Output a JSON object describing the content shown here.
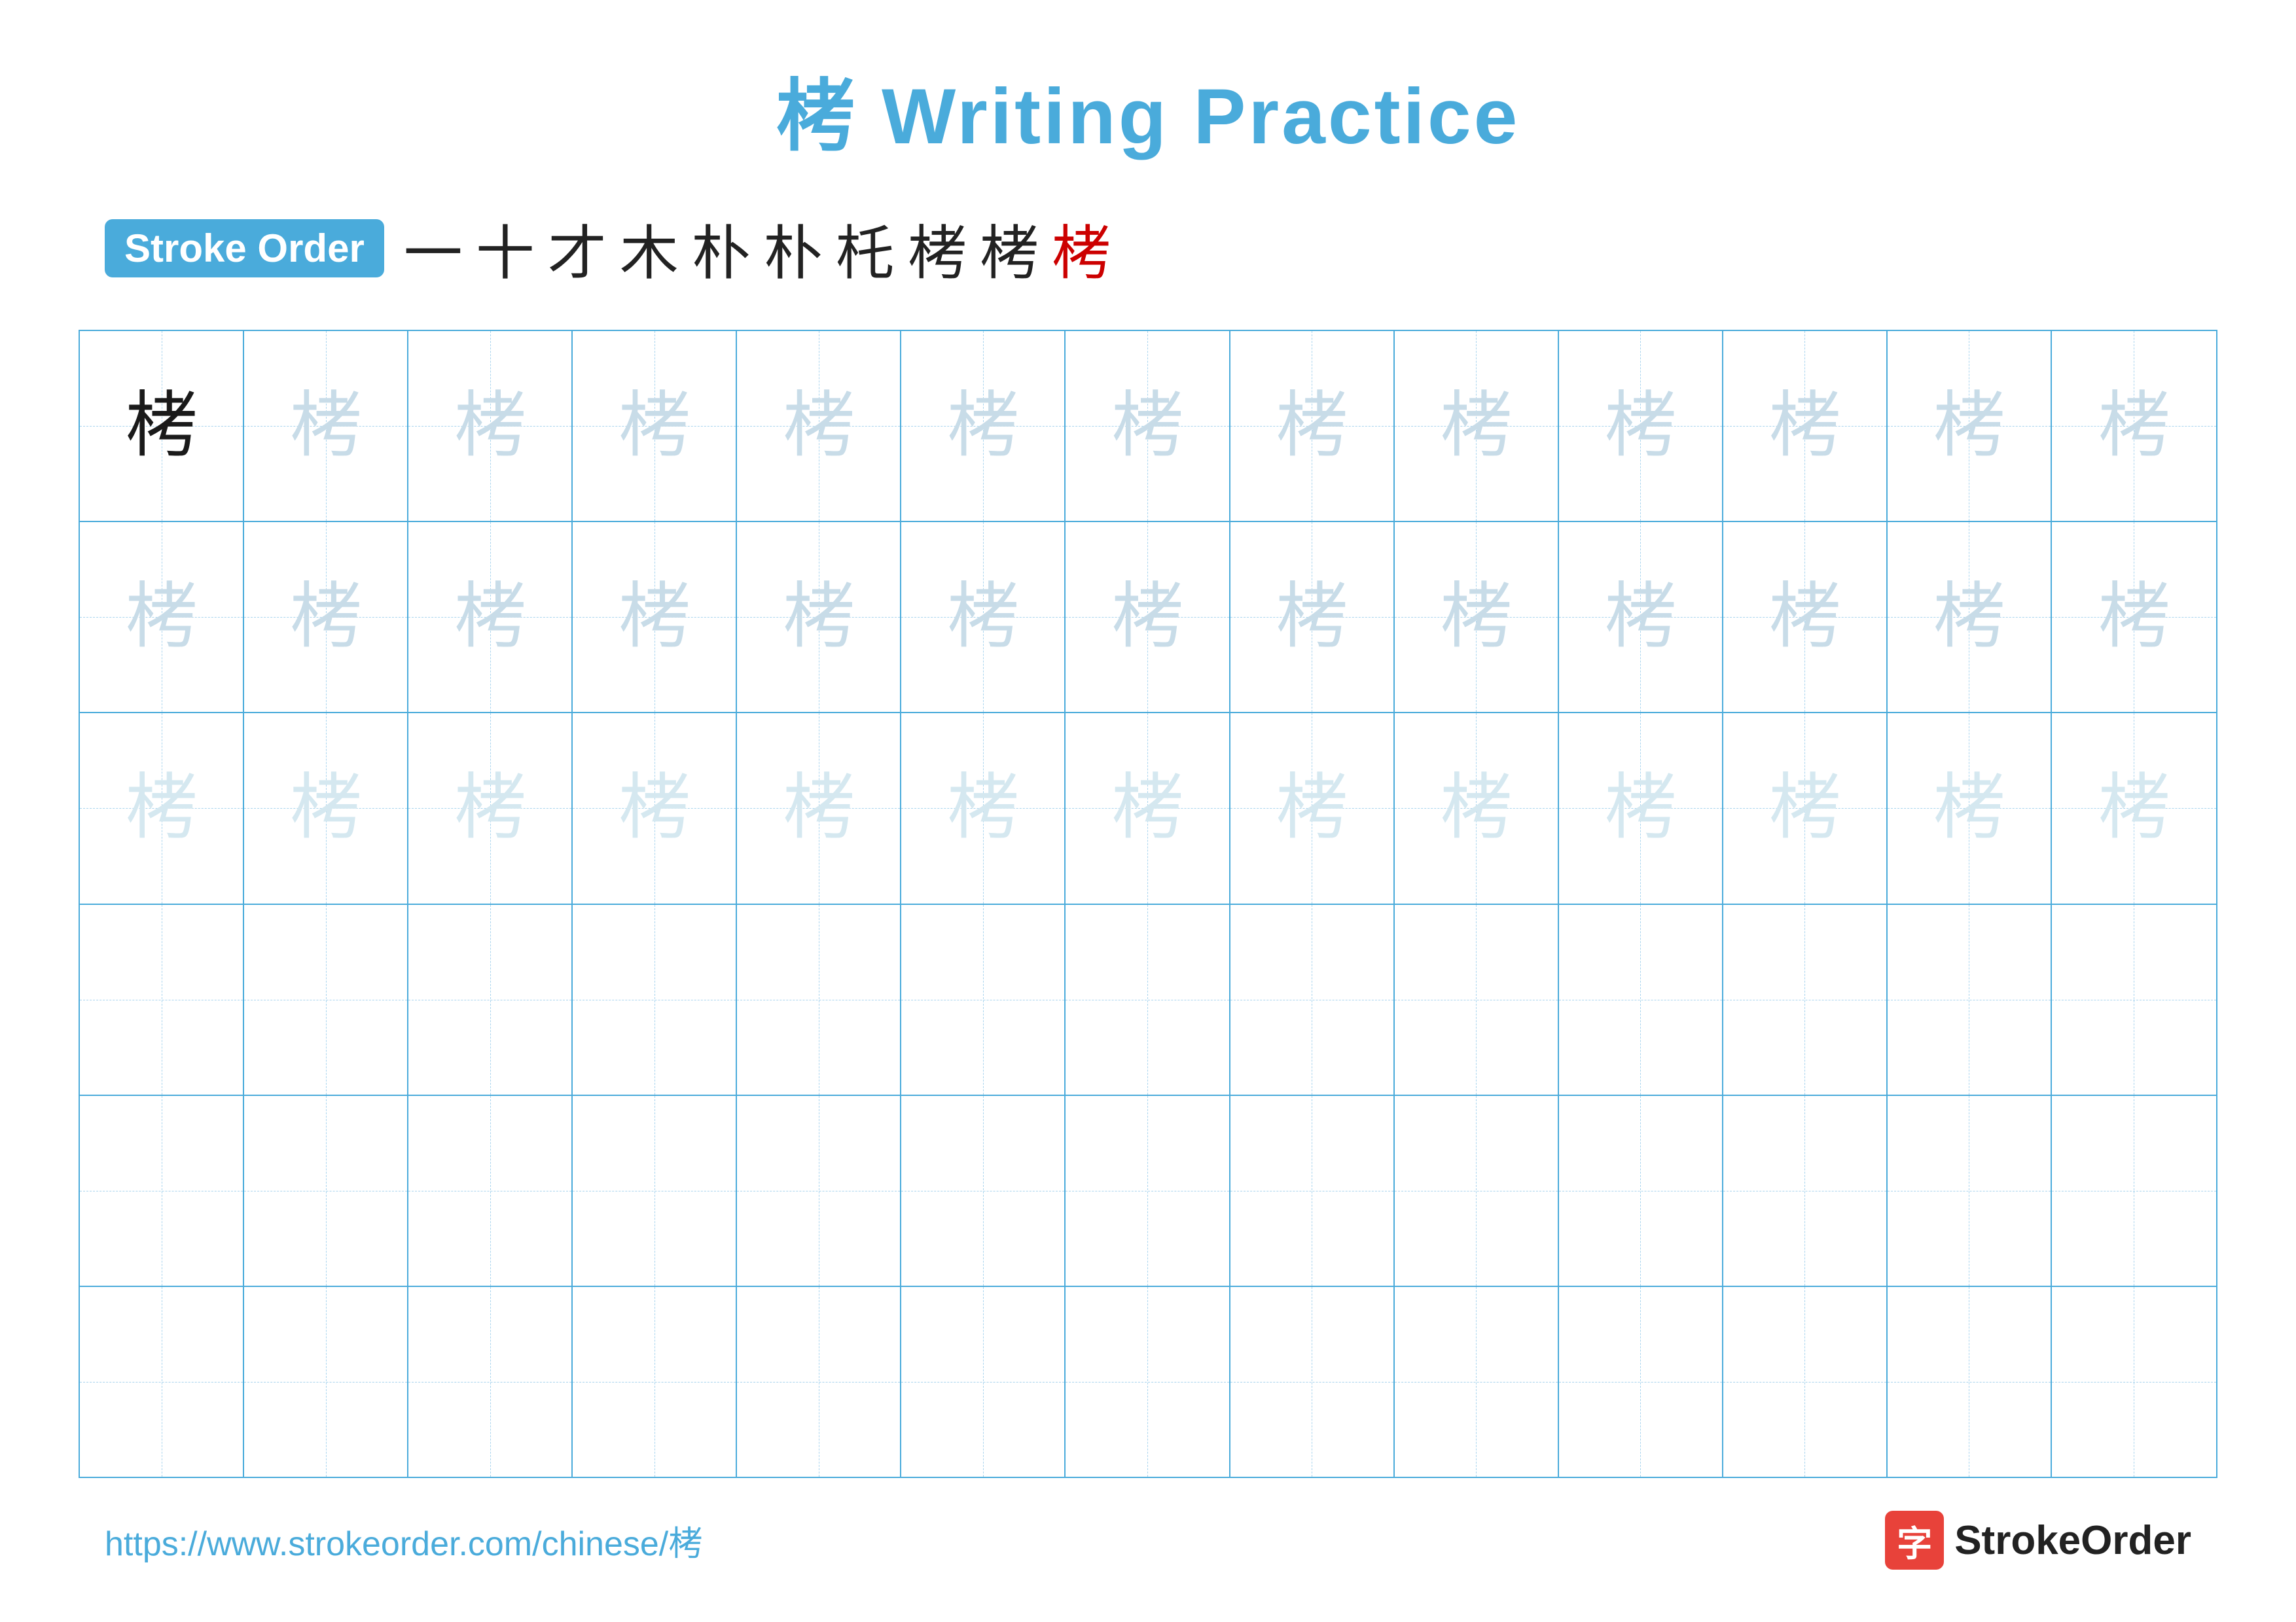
{
  "title": {
    "text": "栲 Writing Practice"
  },
  "stroke_order": {
    "badge_label": "Stroke Order",
    "strokes": [
      {
        "char": "一",
        "color": "black"
      },
      {
        "char": "十",
        "color": "black"
      },
      {
        "char": "才",
        "color": "black"
      },
      {
        "char": "木",
        "color": "black"
      },
      {
        "char": "朴",
        "color": "black"
      },
      {
        "char": "朴↑",
        "color": "black"
      },
      {
        "char": "杖",
        "color": "black"
      },
      {
        "char": "栲",
        "color": "black"
      },
      {
        "char": "栲",
        "color": "black"
      },
      {
        "char": "栲",
        "color": "red"
      }
    ]
  },
  "grid": {
    "rows": 6,
    "cols": 13,
    "char": "栲",
    "row_styles": [
      {
        "style": "first"
      },
      {
        "style": "light"
      },
      {
        "style": "lighter"
      },
      {
        "style": "empty"
      },
      {
        "style": "empty"
      },
      {
        "style": "empty"
      }
    ]
  },
  "footer": {
    "url": "https://www.strokeorder.com/chinese/栲",
    "logo_icon": "字",
    "logo_text": "StrokeOrder"
  }
}
